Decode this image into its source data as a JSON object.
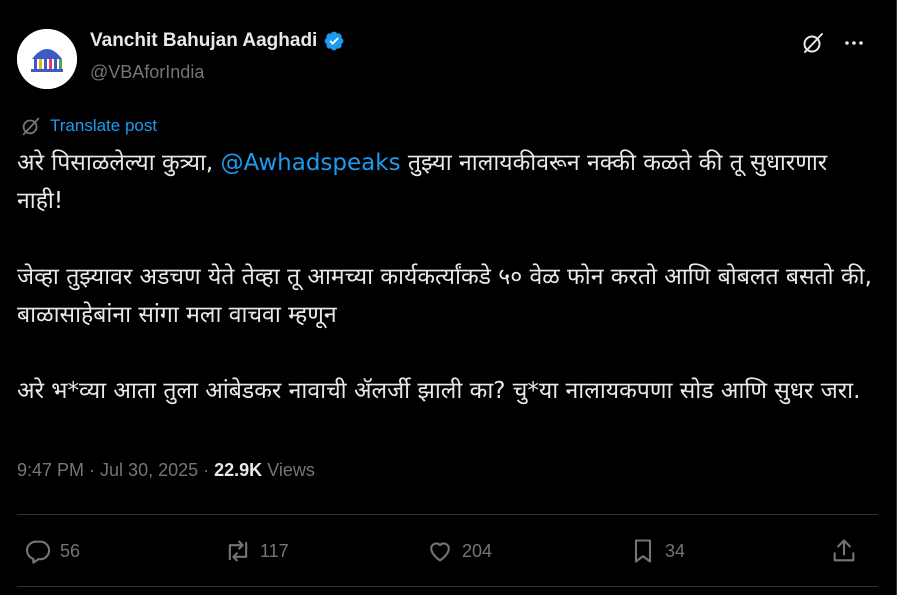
{
  "author": {
    "display_name": "Vanchit Bahujan Aaghadi",
    "handle": "@VBAforIndia",
    "avatar_text": "वंचित बहुजन आघाडी",
    "verified_icon": "verified-badge-icon",
    "verified_color": "#1d9bf0"
  },
  "header_icons": [
    "grok-icon",
    "more-icon"
  ],
  "translate_label": "Translate post",
  "post": {
    "line1_before": "अरे पिसाळलेल्या कुत्र्या, ",
    "mention": "@Awhadspeaks",
    "line1_after": " तुझ्या नालायकीवरून नक्की कळते की तू सुधारणार नाही!",
    "paragraph2": "जेव्हा तुझ्यावर अडचण येते तेव्हा तू आमच्या कार्यकर्त्यांकडे ५० वेळ फोन करतो आणि बोबलत बसतो की, बाळासाहेबांना सांगा मला वाचवा म्हणून",
    "paragraph3": "अरे भ*व्या आता तुला आंबेडकर नावाची ॲलर्जी झाली का? चु*या नालायकपणा सोड आणि सुधर जरा."
  },
  "meta": {
    "time": "9:47 PM",
    "separator": " · ",
    "date": "Jul 30, 2025",
    "views_count": "22.9K",
    "views_label": "Views"
  },
  "actions": {
    "reply": {
      "icon": "reply-icon",
      "count": "56"
    },
    "repost": {
      "icon": "repost-icon",
      "count": "117"
    },
    "like": {
      "icon": "heart-icon",
      "count": "204"
    },
    "bookmark": {
      "icon": "bookmark-icon",
      "count": "34"
    },
    "share": {
      "icon": "share-icon"
    }
  },
  "colors": {
    "background": "#000000",
    "text": "#e7e9ea",
    "secondary": "#71767b",
    "accent": "#1d9bf0",
    "border": "#2f3336"
  }
}
